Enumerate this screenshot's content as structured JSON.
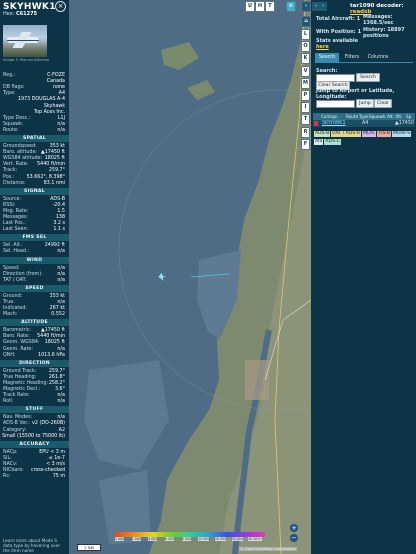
{
  "aircraft": {
    "callsign": "SKYHWK1",
    "hex_label": "Hex:",
    "hex": "C61275",
    "photo_credit": "Image © Marcus Klöckner"
  },
  "details": [
    {
      "k": "Reg.:",
      "v": "C-FOZE"
    },
    {
      "k": "",
      "v": "Canada"
    },
    {
      "k": "DB flags:",
      "v": "none"
    },
    {
      "k": "Type:",
      "v": "A4"
    },
    {
      "k": "",
      "v": "1973 DOUGLAS A-4"
    },
    {
      "k": "",
      "v": "Skyhawk"
    },
    {
      "k": "",
      "v": "Top Aces Inc."
    },
    {
      "k": "Type Desc.:",
      "v": "L1J"
    },
    {
      "k": "Squawk:",
      "v": "n/a"
    },
    {
      "k": "Route:",
      "v": "n/a"
    }
  ],
  "sections": {
    "spatial": "SPATIAL",
    "signal": "SIGNAL",
    "fms": "FMS SEL",
    "wind": "WIND",
    "speed": "SPEED",
    "altitude": "ALTITUDE",
    "direction": "DIRECTION",
    "stuff": "STUFF",
    "accuracy": "ACCURACY"
  },
  "spatial": [
    {
      "k": "Groundspeed:",
      "v": "353 kt"
    },
    {
      "k": "Baro. altitude:",
      "v": "▲17450 ft"
    },
    {
      "k": "WGS84 altitude:",
      "v": "18025 ft"
    },
    {
      "k": "Vert. Rate:",
      "v": "5440 ft/min"
    },
    {
      "k": "Track:",
      "v": "259.7°"
    },
    {
      "k": "Pos.:",
      "v": "53.662°, 8.398°"
    },
    {
      "k": "Distance:",
      "v": "83.1 nmi"
    }
  ],
  "signal": [
    {
      "k": "Source:",
      "v": "ADS-B"
    },
    {
      "k": "RSSI:",
      "v": "-20.4"
    },
    {
      "k": "Msg. Rate:",
      "v": "1.5"
    },
    {
      "k": "Messages:",
      "v": "138"
    },
    {
      "k": "Last Pos.:",
      "v": "3.2 s"
    },
    {
      "k": "Last Seen:",
      "v": "1.1 s"
    }
  ],
  "fms": [
    {
      "k": "Sel. Alt.:",
      "v": "24992 ft"
    },
    {
      "k": "Sel. Head.:",
      "v": "n/a"
    }
  ],
  "wind": [
    {
      "k": "Speed:",
      "v": "n/a"
    },
    {
      "k": "Direction (from):",
      "v": "n/a"
    },
    {
      "k": "TAT / OAT:",
      "v": "n/a"
    }
  ],
  "speed": [
    {
      "k": "Ground:",
      "v": "353 kt"
    },
    {
      "k": "True:",
      "v": "n/a"
    },
    {
      "k": "Indicated:",
      "v": "267 kt"
    },
    {
      "k": "Mach:",
      "v": "0.552"
    }
  ],
  "altitude": [
    {
      "k": "Barometric:",
      "v": "▲17450 ft"
    },
    {
      "k": "Baro. Rate:",
      "v": "5440 ft/min"
    },
    {
      "k": "Geom. WGS84:",
      "v": "18025 ft"
    },
    {
      "k": "Geom. Rate:",
      "v": "n/a"
    },
    {
      "k": "QNH:",
      "v": "1013.6 hPa"
    }
  ],
  "direction": [
    {
      "k": "Ground Track:",
      "v": "259.7°"
    },
    {
      "k": "True Heading:",
      "v": "261.8°"
    },
    {
      "k": "Magnetic Heading:",
      "v": "258.2°"
    },
    {
      "k": "Magnetic Decl.:",
      "v": "3.6°"
    },
    {
      "k": "Track Rate:",
      "v": "n/a"
    },
    {
      "k": "Roll:",
      "v": "n/a"
    }
  ],
  "stuff": [
    {
      "k": "Nav. Modes:",
      "v": "n/a"
    },
    {
      "k": "ADS-B Ver.:",
      "v": "v2 (DO-260B)"
    },
    {
      "k": "Category:",
      "v": "A2"
    },
    {
      "k": "",
      "v": "Small (15500 to 75000 lb)"
    }
  ],
  "accuracy": [
    {
      "k": "NACp:",
      "v": "EPU < 3 m"
    },
    {
      "k": "SIL:",
      "v": "≤ 1e-7"
    },
    {
      "k": "NACv:",
      "v": "< 3 m/s"
    },
    {
      "k": "NICbaro:",
      "v": "cross-checked"
    },
    {
      "k": "Rc:",
      "v": "75 m"
    }
  ],
  "footer_note": "Learn more about Mode S data type by hovering over",
  "footer_note2": "the item name",
  "map": {
    "top_buttons": [
      "U",
      "H",
      "T"
    ],
    "side_buttons": [
      "L",
      "O",
      "K",
      "V",
      "M",
      "P",
      "I",
      "T",
      "R",
      "F"
    ],
    "scale": "2 NM",
    "zoom_in": "+",
    "zoom_out": "−",
    "attribution": "© OpenStreetMap contributors",
    "altitude_ticks": [
      "1 000",
      "2 000",
      "4 000",
      "6 000",
      "8 000",
      "10 000",
      "20 000",
      "30 000",
      "40 000+"
    ]
  },
  "right": {
    "decoder_prefix": "tar1090",
    "decoder_text": "decoder:",
    "decoder_link": "readsb",
    "total_aircraft_label": "Total Aircraft:",
    "total_aircraft": "1",
    "with_position_label": "With Position:",
    "with_position": "1",
    "messages_label": "Messages:",
    "messages": "1368.5/sec",
    "history_label": "History:",
    "history": "18897 positions",
    "stats_label": "Stats available",
    "stats_link": "here",
    "tabs": [
      "Search",
      "Filters",
      "Columns"
    ],
    "search_label": "Search:",
    "search_button": "Search",
    "clear_search": "Clear Search",
    "jump_label": "Jump to Airport or Latitude, Longitude:",
    "jump_button": "Jump",
    "clear_button": "Clear",
    "table_headers": [
      "Callsign",
      "Route",
      "Type",
      "Squawk",
      "Alt. (ft)",
      "Sp"
    ],
    "table_row": {
      "callsign": "SKYHWK1",
      "type": "A4",
      "alt": "▲17450"
    },
    "tags": [
      "ADS-B",
      "UAT / ADS-R",
      "MLAT",
      "TIS-B",
      "Mode-S",
      "AIS",
      "ADS-C"
    ],
    "tag_colors": [
      "#c5e2b8",
      "#e7d48c",
      "#d9b5e6",
      "#f0a89a",
      "#b8d8ee",
      "#d8e8ee",
      "#a8e2c5"
    ]
  }
}
